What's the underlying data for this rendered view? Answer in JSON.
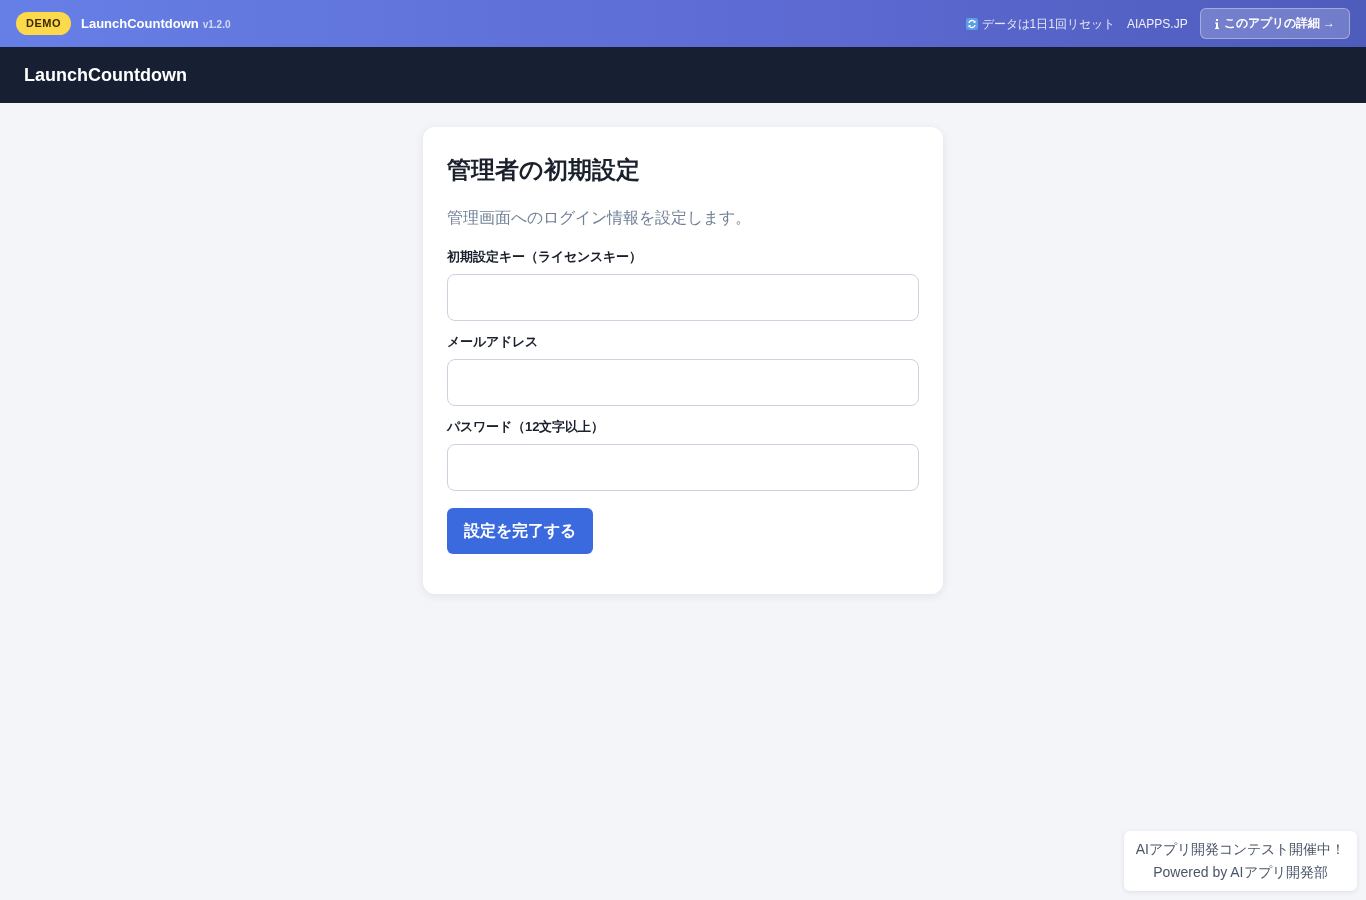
{
  "demo_bar": {
    "badge": "DEMO",
    "app_name": "LaunchCountdown",
    "version": "v1.2.0",
    "reset_notice": "データは1日1回リセット",
    "site_link": "AIAPPS.JP",
    "details_button": "このアプリの詳細 →"
  },
  "header": {
    "title": "LaunchCountdown"
  },
  "setup_card": {
    "title": "管理者の初期設定",
    "description": "管理画面へのログイン情報を設定します。",
    "fields": [
      {
        "label": "初期設定キー（ライセンスキー）"
      },
      {
        "label": "メールアドレス"
      },
      {
        "label": "パスワード（12文字以上）"
      }
    ],
    "submit_button": "設定を完了する"
  },
  "footer_badge": {
    "lines": [
      "AIアプリ開発コンテスト開催中！",
      "Powered by AIアプリ開発部"
    ]
  }
}
